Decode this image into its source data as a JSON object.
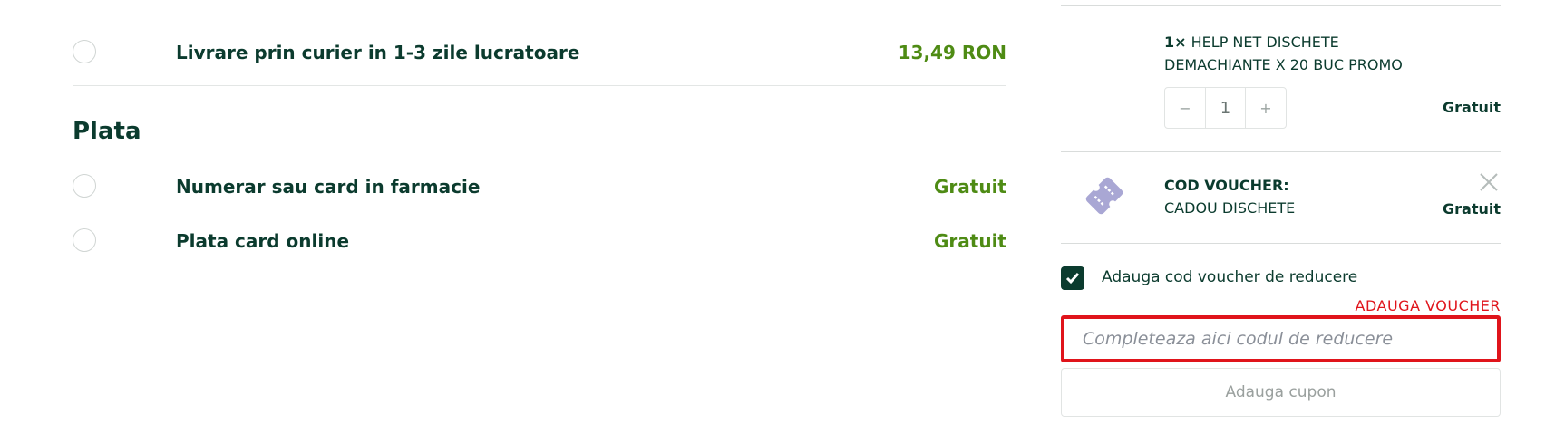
{
  "shipping": {
    "options": [
      {
        "label": "Livrare prin curier in 1-3 zile lucratoare",
        "price": "13,49 RON"
      }
    ]
  },
  "payment": {
    "title": "Plata",
    "options": [
      {
        "label": "Numerar sau card in farmacie",
        "price": "Gratuit"
      },
      {
        "label": "Plata card online",
        "price": "Gratuit"
      }
    ]
  },
  "cart": {
    "product": {
      "qty_prefix": "1×",
      "name_line1": "HELP NET DISCHETE",
      "name_line2": "DEMACHIANTE X 20 BUC PROMO",
      "quantity": "1",
      "minus": "−",
      "plus": "+",
      "price": "Gratuit"
    },
    "voucher": {
      "title": "COD VOUCHER:",
      "code": "CADOU DISCHETE",
      "price": "Gratuit",
      "icon": "voucher-ticket-icon"
    },
    "discount": {
      "checkbox_label": "Adauga cod voucher de reducere",
      "checked": true,
      "note": "ADAUGA VOUCHER",
      "input_placeholder": "Completeaza aici codul de reducere",
      "input_value": "",
      "button_label": "Adauga cupon"
    }
  },
  "colors": {
    "text": "#0b3b2e",
    "price_green": "#4e8b14",
    "highlight_red": "#e0141b",
    "icon_purple": "#a9a7d4"
  }
}
